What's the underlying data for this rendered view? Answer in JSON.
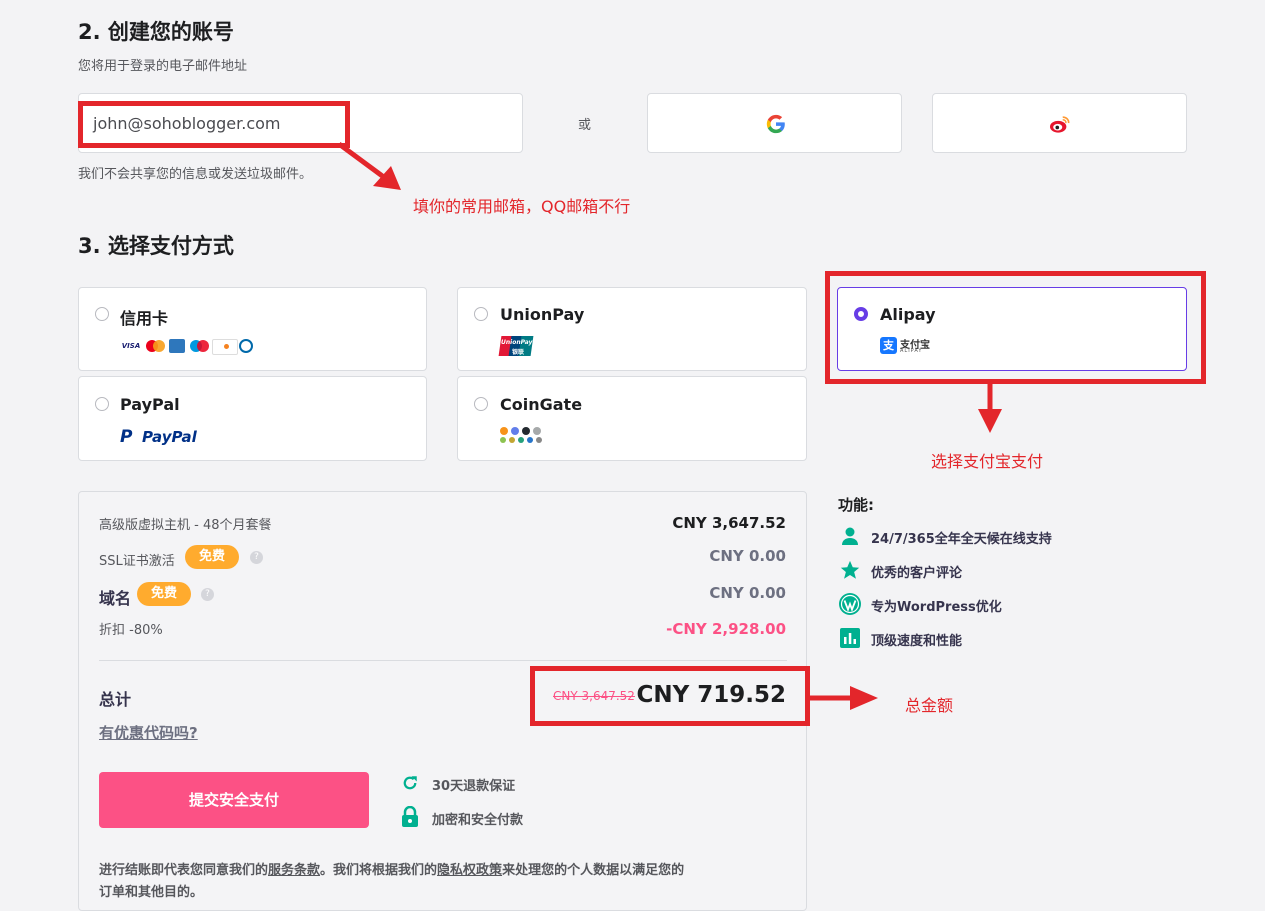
{
  "section2": {
    "title": "2. 创建您的账号",
    "subtitle": "您将用于登录的电子邮件地址",
    "email_value": "john@sohoblogger.com",
    "or_text": "或",
    "note": "我们不会共享您的信息或发送垃圾邮件。",
    "annotation": "填你的常用邮箱，QQ邮箱不行"
  },
  "section3": {
    "title": "3. 选择支付方式",
    "methods": [
      {
        "name": "信用卡",
        "selected": false
      },
      {
        "name": "UnionPay",
        "selected": false
      },
      {
        "name": "Alipay",
        "selected": true
      },
      {
        "name": "PayPal",
        "selected": false
      },
      {
        "name": "CoinGate",
        "selected": false
      }
    ],
    "card_brands": [
      "VISA"
    ],
    "unionpay_logo_text": "UnionPay",
    "unionpay_logo_cn": "银联",
    "alipay_logo_cn": "支付宝",
    "alipay_logo_en": "ALIPAY",
    "paypal_logo_text": "PayPal",
    "annotation": "选择支付宝支付"
  },
  "summary": {
    "lines": [
      {
        "label": "高级版虚拟主机 - 48个月套餐",
        "value": "CNY 3,647.52"
      },
      {
        "label": "SSL证书激活",
        "badge": "免费",
        "value": "CNY 0.00"
      },
      {
        "label": "域名",
        "badge": "免费",
        "value": "CNY 0.00"
      },
      {
        "label": "折扣 -80%",
        "value": "-CNY 2,928.00"
      }
    ],
    "total_label": "总计",
    "total_old": "CNY 3,647.52",
    "total_new": "CNY 719.52",
    "coupon_link": "有优惠代码吗?",
    "submit_label": "提交安全支付",
    "guarantee1": "30天退款保证",
    "guarantee2": "加密和安全付款",
    "legal_1": "进行结账即代表您同意我们的",
    "legal_tos": "服务条款",
    "legal_2": "。我们将根据我们的",
    "legal_privacy": "隐私权政策",
    "legal_3": "来处理您的个人数据以满足您的",
    "legal_4": "订单和其他目的。",
    "annotation": "总金额"
  },
  "features": {
    "title": "功能:",
    "items": [
      "24/7/365全年全天候在线支持",
      "优秀的客户评论",
      "专为WordPress优化",
      "顶级速度和性能"
    ]
  },
  "colors": {
    "accent": "#673de6",
    "pink": "#fc5185",
    "annotation_red": "#e3262b",
    "feature_green": "#00b090",
    "badge_orange": "#ffab2e"
  }
}
